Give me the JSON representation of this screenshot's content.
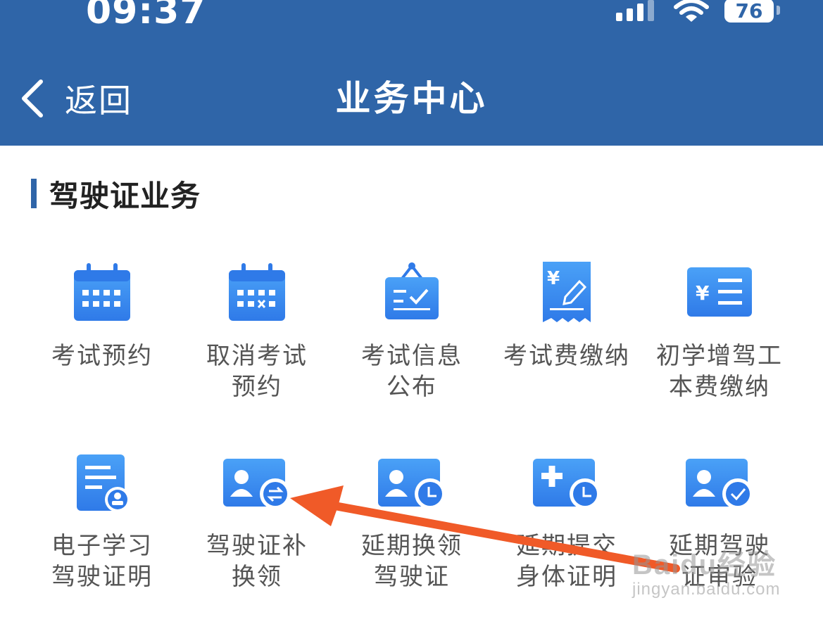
{
  "status_bar": {
    "time": "09:37",
    "battery": "76"
  },
  "nav": {
    "back_label": "返回",
    "title": "业务中心"
  },
  "section": {
    "title": "驾驶证业务"
  },
  "services": [
    {
      "label": "考试预约",
      "icon": "calendar-icon"
    },
    {
      "label": "取消考试\n预约",
      "icon": "calendar-cancel-icon"
    },
    {
      "label": "考试信息\n公布",
      "icon": "notice-board-icon"
    },
    {
      "label": "考试费缴纳",
      "icon": "receipt-icon"
    },
    {
      "label": "初学增驾工\n本费缴纳",
      "icon": "payment-card-icon"
    },
    {
      "label": "电子学习\n驾驶证明",
      "icon": "document-user-icon"
    },
    {
      "label": "驾驶证补\n换领",
      "icon": "license-exchange-icon"
    },
    {
      "label": "延期换领\n驾驶证",
      "icon": "license-clock-icon"
    },
    {
      "label": "延期提交\n身体证明",
      "icon": "medical-clock-icon"
    },
    {
      "label": "延期驾驶\n证审验",
      "icon": "license-check-icon"
    }
  ],
  "colors": {
    "header": "#2f65a8",
    "icon_blue": "#3a8ef0",
    "annotation_arrow": "#f05a28"
  },
  "watermark": {
    "brand": "Baidu经验",
    "url": "jingyan.baidu.com"
  }
}
